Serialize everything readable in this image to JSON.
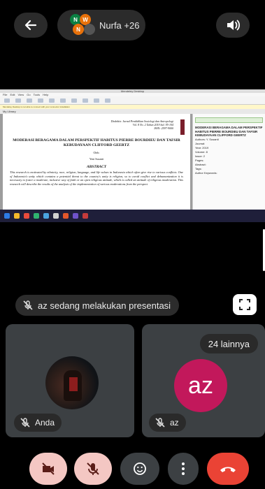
{
  "header": {
    "meeting_label": "Nurfa +26",
    "avatar_letters": [
      "N",
      "W",
      "N"
    ]
  },
  "shared_screen": {
    "window_title": "Mendeley Desktop",
    "menu": "File  Edit  View  Go  Tools  Help",
    "notice": "Mendeley Desktop is not able to connect with your connector installation",
    "tab_label": "My Library",
    "journal_line1": "Dialektis: Jurnal Pendidikan Sosiologi dan Antropologi",
    "journal_line2": "Vol. 8 No. 2 Tahun 2019 hal. 95-104",
    "journal_line3": "ISSN: 2597-9000",
    "paper_title": "MODERASI BERAGAMA DALAM PERSPEKTIF HABITUS PIERRE BOURDIEU DAN TAFSIR KEBUDAYAAN CLIFFORD GEERTZ",
    "oleh": "Oleh:",
    "author": "Yeni Susanti",
    "abstract_heading": "ABSTRACT",
    "abstract_text": "This research is motivated by ethnicity, race, religion, language, and life values in Indonesia which often give rise to various conflicts. One of Indonesia's unity which contains a potential threat to the country's unity is religion, so to avoid conflict and dehumanization it is necessary to foster a moderate, inclusive way of faith or an open religious attitude, which is called an attitude of religious moderation. This research will describe the results of the analysis of the implementation of various moderations from the perspect",
    "side_title": "MODERASI BERAGAMA DALAM PERSPEKTIF HABITUS PIERRE BOURDIEU DAN TAFSIR KEBUDAYAAN CLIFFORD GEERTZ",
    "side_rows": [
      "Authors: Y. Susanti",
      "Journal:",
      "Year: 2019",
      "Volume: 8",
      "Issue: 2",
      "Pages:",
      "Abstract:",
      "Tags:",
      "Author Keywords:"
    ]
  },
  "presenting_text": "az sedang melakukan presentasi",
  "tiles": {
    "you_label": "Anda",
    "az_label": "az",
    "az_initials": "az",
    "more_label": "24 lainnya"
  }
}
